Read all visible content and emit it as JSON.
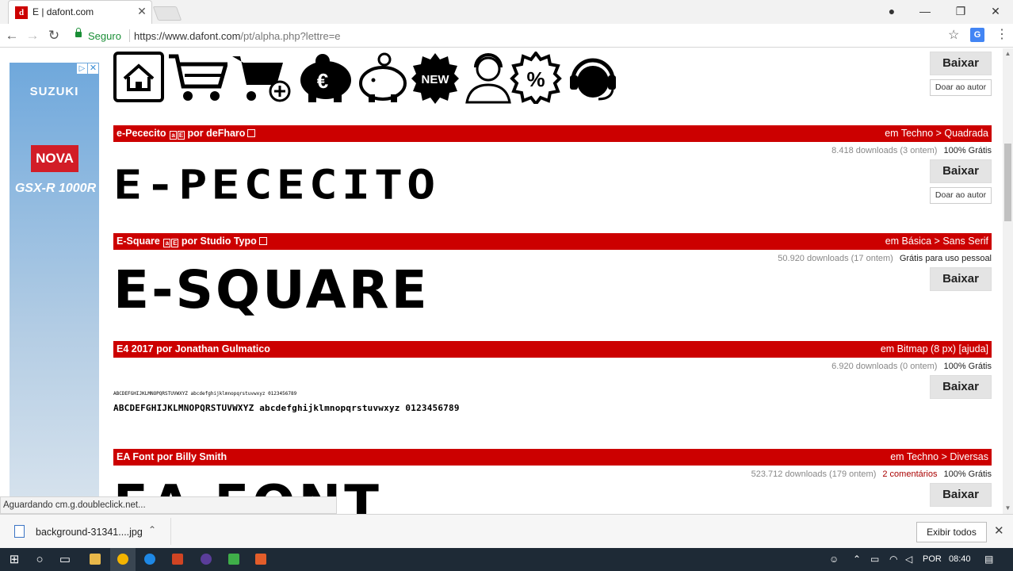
{
  "browser": {
    "tab_title": "E | dafont.com",
    "tab_favicon": "d",
    "secure_label": "Seguro",
    "url_main": "https://www.dafont.com",
    "url_rest": "/pt/alpha.php?lettre=e"
  },
  "icon_font": {
    "icons": [
      "home-icon",
      "cart-icon",
      "cart-add-icon",
      "euro-piggy-icon",
      "piggy-bank-icon",
      "new-badge-icon",
      "support-agent-icon",
      "percent-badge-icon",
      "headset-icon"
    ],
    "baixar_label": "Baixar",
    "doar_label": "Doar ao autor",
    "new_label": "NEW"
  },
  "fonts": [
    {
      "name": "e-Pececito",
      "author_prefix": "por",
      "author": "deFharo",
      "category": "em Techno > Quadrada",
      "downloads": "8.418 downloads (3 ontem)",
      "license": "100% Grátis",
      "comments": "",
      "preview": "E-PECECITO",
      "baixar_label": "Baixar",
      "doar_label": "Doar ao autor"
    },
    {
      "name": "E-Square",
      "author_prefix": "por",
      "author": "Studio Typo",
      "category": "em Básica > Sans Serif",
      "downloads": "50.920 downloads (17 ontem)",
      "license": "Grátis para uso pessoal",
      "comments": "",
      "preview": "E-SQUARE",
      "baixar_label": "Baixar"
    },
    {
      "name": "E4 2017",
      "author_prefix": "por",
      "author": "Jonathan Gulmatico",
      "category": "em Bitmap (8 px) [ajuda]",
      "downloads": "6.920 downloads (0 ontem)",
      "license": "100% Grátis",
      "comments": "",
      "preview_small": "ABCDEFGHIJKLMNOPQRSTUVWXYZ abcdefghijklmnopqrstuvwxyz 0123456789",
      "preview": "ABCDEFGHIJKLMNOPQRSTUVWXYZ abcdefghijklmnopqrstuvwxyz 0123456789",
      "baixar_label": "Baixar"
    },
    {
      "name": "EA Font",
      "author_prefix": "por",
      "author": "Billy Smith",
      "category": "em Techno > Diversas",
      "downloads": "523.712 downloads (179 ontem)",
      "license": "100% Grátis",
      "comments": "2 comentários",
      "preview": "EA FONT",
      "baixar_label": "Baixar"
    }
  ],
  "ad": {
    "brand": "SUZUKI",
    "badge": "NOVA",
    "model": "GSX-R 1000R"
  },
  "status_text": "Aguardando cm.g.doubleclick.net...",
  "download": {
    "filename": "background-31341....jpg",
    "show_all": "Exibir todos"
  },
  "taskbar": {
    "lang": "POR",
    "time": "08:40"
  },
  "colors": {
    "accent_red": "#cc0000",
    "secure_green": "#1a8e36",
    "taskbar": "#1e2a36"
  }
}
